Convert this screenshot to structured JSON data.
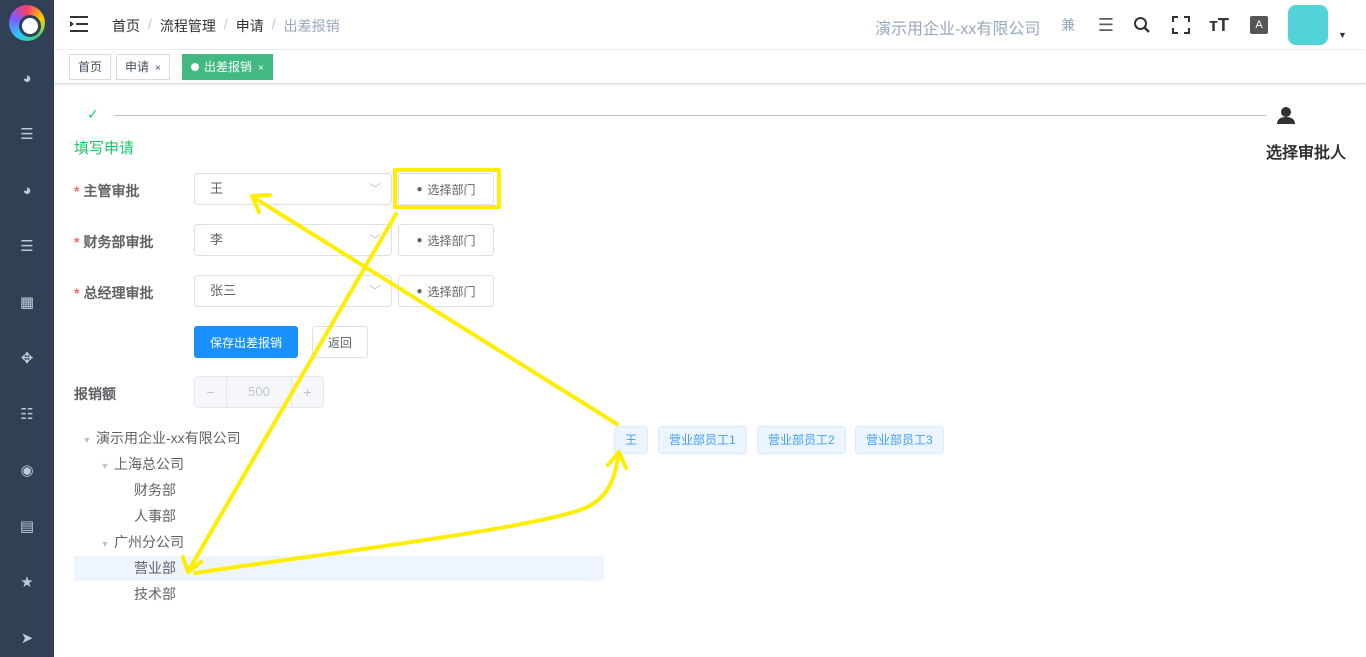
{
  "colors": {
    "sidebar": "#304156",
    "accent": "#13ce66",
    "primary": "#1890ff",
    "tag_active": "#42b983",
    "annotation": "#ffee00"
  },
  "sidebar": {
    "icons": [
      "dashboard-icon",
      "list-icon",
      "dashboard-icon",
      "list-icon",
      "grid-icon",
      "target-icon",
      "tree-list-icon",
      "eye-icon",
      "table-icon",
      "star-icon",
      "send-icon"
    ]
  },
  "header": {
    "breadcrumb": [
      "首页",
      "流程管理",
      "申请",
      "出差报销"
    ],
    "separator": "/",
    "company": "演示用企业-xx有限公司",
    "jian": "兼"
  },
  "tags": [
    {
      "label": "首页"
    },
    {
      "label": "申请",
      "close": "×"
    },
    {
      "label": "出差报销",
      "close": "×"
    }
  ],
  "steps": {
    "step1": "填写申请",
    "step2": "选择审批人",
    "check": "✓"
  },
  "form": {
    "manager": {
      "label": "主管审批",
      "value": "王"
    },
    "finance": {
      "label": "财务部审批",
      "value": "李"
    },
    "gm": {
      "label": "总经理审批",
      "value": "张三"
    },
    "dept_btn": "选择部门",
    "required_mark": "*",
    "save": "保存出差报销",
    "back": "返回",
    "amount_label": "报销额",
    "amount": "500",
    "minus": "−",
    "plus": "+"
  },
  "tree": {
    "root": "演示用企业-xx有限公司",
    "shanghai": "上海总公司",
    "finance": "财务部",
    "hr": "人事部",
    "guangzhou": "广州分公司",
    "sales": "营业部",
    "tech": "技术部"
  },
  "employees": [
    "王",
    "营业部员工1",
    "营业部员工2",
    "营业部员工3"
  ]
}
